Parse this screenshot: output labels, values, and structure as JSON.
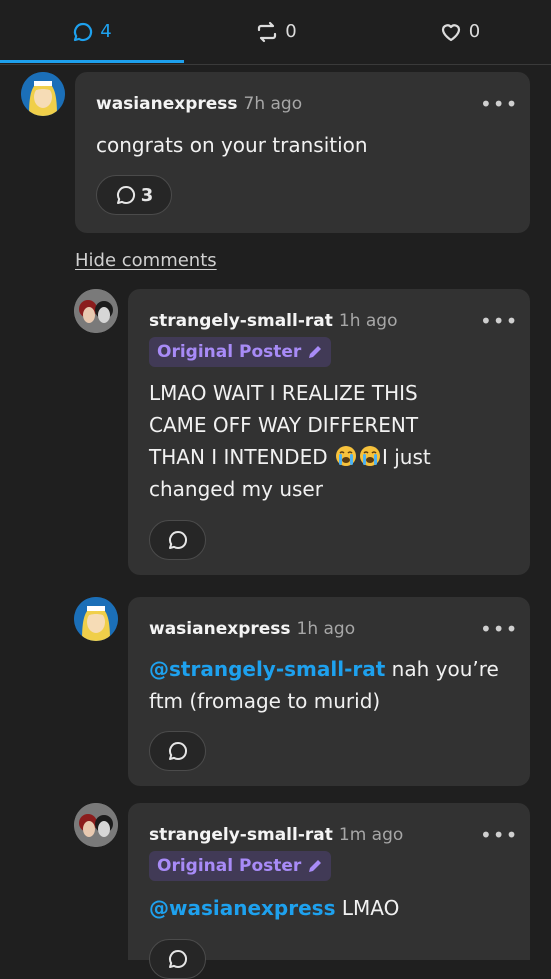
{
  "tabs": [
    {
      "icon": "comment-icon",
      "count": "4",
      "active": true
    },
    {
      "icon": "reblog-icon",
      "count": "0",
      "active": false
    },
    {
      "icon": "heart-icon",
      "count": "0",
      "active": false
    }
  ],
  "colors": {
    "accent": "#1ea1ee",
    "badge_text": "#a88bf7",
    "card": "#323232",
    "background": "#1f1f1f"
  },
  "comments": [
    {
      "username": "wasianexpress",
      "time": "7h ago",
      "text": "congrats on your transition",
      "reply_count": "3",
      "more_label": "•••"
    },
    {
      "username": "strangely-small-rat",
      "time": "1h ago",
      "badge": "Original Poster",
      "text_lines": [
        "LMAO WAIT I REALIZE THIS",
        "CAME OFF WAY DIFFERENT",
        "THAN I INTENDED",
        "I just",
        "changed my user"
      ],
      "emoji": "loudly-crying-face",
      "more_label": "•••"
    },
    {
      "username": "wasianexpress",
      "time": "1h ago",
      "mention": "@strangely-small-rat",
      "text_part1": " nah you’re",
      "text_line2": "ftm (fromage to murid)",
      "more_label": "•••"
    },
    {
      "username": "strangely-small-rat",
      "time": "1m ago",
      "badge": "Original Poster",
      "mention": "@wasianexpress",
      "text": " LMAO",
      "more_label": "•••"
    }
  ],
  "hide_comments_label": "Hide comments"
}
